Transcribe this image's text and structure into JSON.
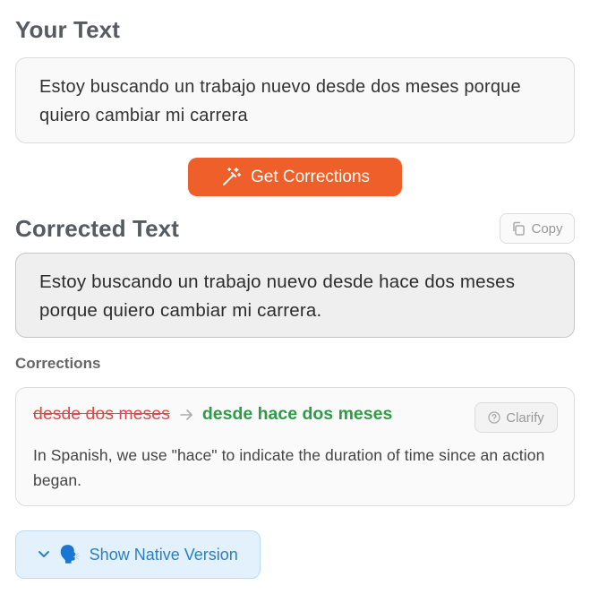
{
  "input_section": {
    "title": "Your Text",
    "text": "Estoy buscando un trabajo nuevo desde dos meses porque quiero cambiar mi carrera"
  },
  "actions": {
    "get_corrections_label": "Get Corrections",
    "copy_label": "Copy"
  },
  "output_section": {
    "title": "Corrected Text",
    "text": "Estoy buscando un trabajo nuevo desde hace dos meses porque quiero cambiar mi carrera."
  },
  "corrections": {
    "label": "Corrections",
    "items": [
      {
        "original": "desde dos meses",
        "corrected": "desde hace dos meses",
        "clarify_label": "Clarify",
        "explanation": "In Spanish, we use \"hace\" to indicate the duration of time since an action began."
      }
    ]
  },
  "native_version": {
    "label": "Show Native Version",
    "emoji": "🗣️"
  },
  "colors": {
    "primary_button": "#ee5f2a",
    "removed_text": "#e04848",
    "added_text": "#2f9b46",
    "native_button_bg": "#e3f1fc",
    "native_button_text": "#2a7fc4"
  },
  "icons": {
    "get_corrections": "magic-wand-icon",
    "copy": "copy-icon",
    "arrow": "arrow-right-icon",
    "clarify": "question-circle-icon",
    "expand": "chevron-down-icon",
    "speak": "speaking-head-icon"
  }
}
